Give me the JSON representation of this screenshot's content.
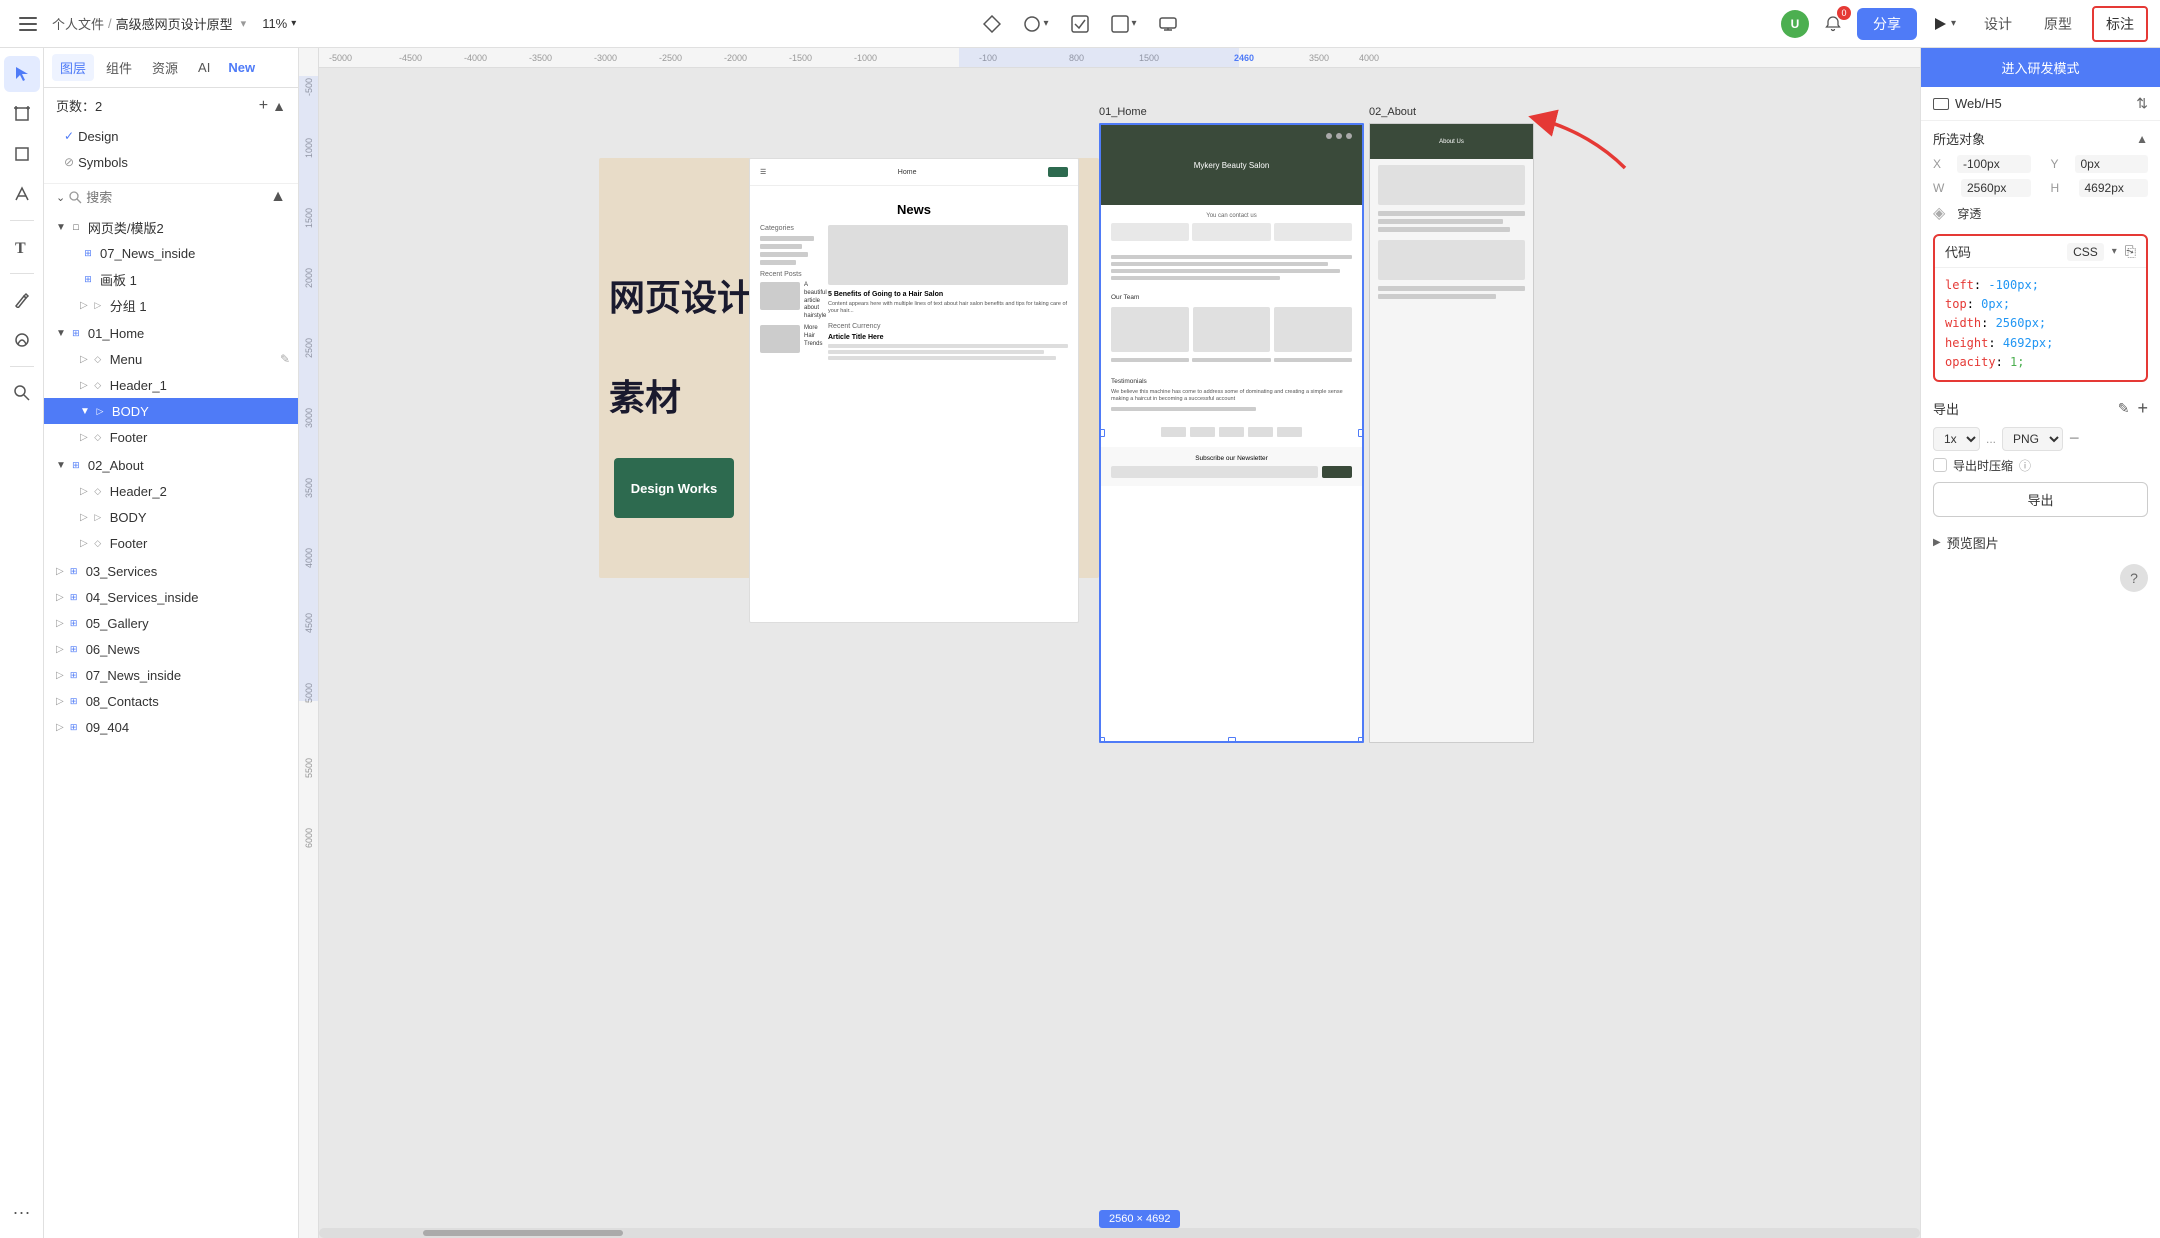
{
  "app": {
    "title": "高级感网页设计原型",
    "breadcrumb": [
      "个人文件",
      "高级感网页设计原型"
    ],
    "zoom": "11%",
    "tabs": {
      "left": [
        "图层",
        "组件",
        "资源",
        "AI",
        "New"
      ],
      "right": [
        "设计",
        "原型",
        "标注"
      ]
    },
    "active_left_tab": "图层",
    "active_right_tab": "标注"
  },
  "toolbar": {
    "menu_label": "☰",
    "share_label": "分享",
    "play_label": "▶",
    "design_label": "设计",
    "prototype_label": "原型",
    "mark_label": "标注",
    "zoom_label": "11%"
  },
  "left_panel": {
    "page_count_label": "页数：2",
    "pages": [
      {
        "name": "Design",
        "has_check": true
      },
      {
        "name": "Symbols",
        "has_check": false
      }
    ],
    "search_placeholder": "搜索",
    "tree": [
      {
        "label": "网页类/模版2",
        "indent": 0,
        "type": "group",
        "icon": "□"
      },
      {
        "label": "07_News_inside",
        "indent": 1,
        "type": "frame",
        "icon": "⊞"
      },
      {
        "label": "画板 1",
        "indent": 1,
        "type": "frame",
        "icon": "⊞"
      },
      {
        "label": "分组 1",
        "indent": 1,
        "type": "folder",
        "icon": "▷"
      },
      {
        "label": "01_Home",
        "indent": 0,
        "type": "frame",
        "icon": "⊞"
      },
      {
        "label": "Menu",
        "indent": 1,
        "type": "group",
        "icon": "◇",
        "hidden": true
      },
      {
        "label": "Header_1",
        "indent": 1,
        "type": "group",
        "icon": "◇"
      },
      {
        "label": "BODY",
        "indent": 1,
        "type": "folder",
        "icon": "▷",
        "selected": true
      },
      {
        "label": "Footer",
        "indent": 1,
        "type": "group",
        "icon": "◇"
      },
      {
        "label": "02_About",
        "indent": 0,
        "type": "frame",
        "icon": "⊞"
      },
      {
        "label": "Header_2",
        "indent": 1,
        "type": "group",
        "icon": "◇"
      },
      {
        "label": "BODY",
        "indent": 1,
        "type": "folder",
        "icon": "▷"
      },
      {
        "label": "Footer",
        "indent": 1,
        "type": "group",
        "icon": "◇"
      },
      {
        "label": "03_Services",
        "indent": 0,
        "type": "frame",
        "icon": "⊞"
      },
      {
        "label": "04_Services_inside",
        "indent": 0,
        "type": "frame",
        "icon": "⊞"
      },
      {
        "label": "05_Gallery",
        "indent": 0,
        "type": "frame",
        "icon": "⊞"
      },
      {
        "label": "06_News",
        "indent": 0,
        "type": "frame",
        "icon": "⊞"
      },
      {
        "label": "07_News_inside",
        "indent": 0,
        "type": "frame",
        "icon": "⊞"
      },
      {
        "label": "08_Contacts",
        "indent": 0,
        "type": "frame",
        "icon": "⊞"
      },
      {
        "label": "09_404",
        "indent": 0,
        "type": "frame",
        "icon": "⊞"
      }
    ]
  },
  "canvas": {
    "rulers_h": [
      "-5000",
      "-4500",
      "-4000",
      "-3500",
      "-3000",
      "-2500",
      "-2000",
      "-1500",
      "-1000",
      "-100",
      "800",
      "1500",
      "2460",
      "3500",
      "4000"
    ],
    "rulers_v": [
      "-500",
      "-500",
      "1000",
      "1500",
      "2000",
      "2500",
      "3000",
      "3500",
      "4000",
      "4500",
      "5000",
      "5500",
      "6000"
    ],
    "frames": {
      "news_title": "News",
      "beauty_label": "01_Home",
      "about_label": "02_About",
      "beauty_title": "Mykery Beauty Salon",
      "about_title": "About Us",
      "size_label": "2560 × 4692",
      "design_works": "Design Works"
    }
  },
  "right_panel": {
    "dev_mode_btn": "进入研发模式",
    "web_h5_label": "Web/H5",
    "selection_title": "所选对象",
    "properties": {
      "x_label": "X",
      "x_value": "-100px",
      "y_label": "Y",
      "y_value": "0px",
      "w_label": "W",
      "w_value": "2560px",
      "h_label": "H",
      "h_value": "4692px",
      "opacity_label": "◈",
      "opacity_value": "穿透"
    },
    "code_panel": {
      "title": "代码",
      "format": "CSS",
      "code": [
        {
          "prop": "left",
          "val": "-100px;"
        },
        {
          "prop": "top",
          "val": "0px;"
        },
        {
          "prop": "width",
          "val": "2560px;"
        },
        {
          "prop": "height",
          "val": "4692px;"
        },
        {
          "prop": "opacity",
          "val": "1;"
        }
      ]
    },
    "export": {
      "title": "导出",
      "scale": "1x",
      "format": "PNG",
      "compress_label": "导出时压缩",
      "compress_info": "ⓘ",
      "export_btn": "导出",
      "remove_btn": "−"
    },
    "preview": {
      "title": "预览图片",
      "arrow": "▶"
    }
  }
}
